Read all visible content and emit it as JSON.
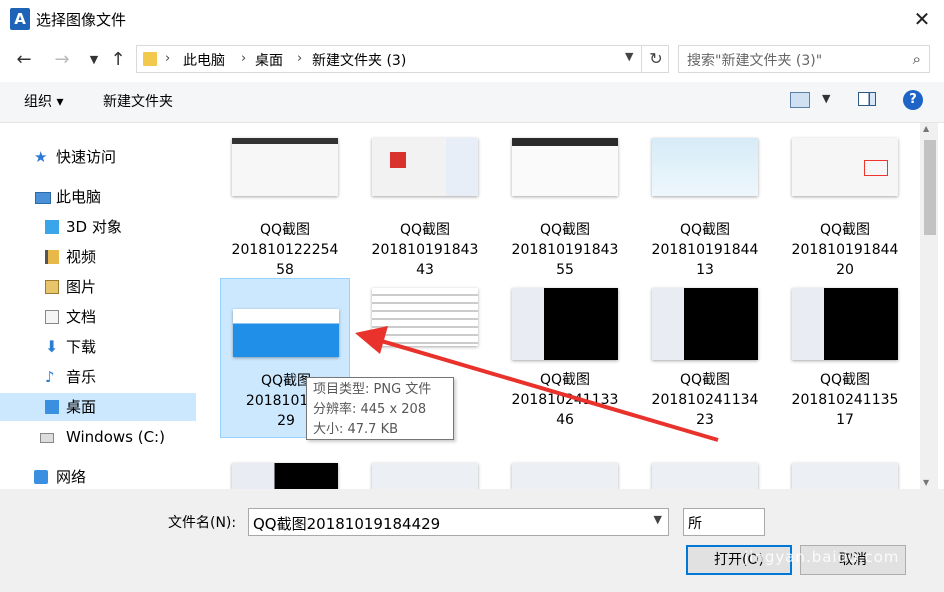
{
  "window": {
    "title": "选择图像文件",
    "close_glyph": "✕",
    "app_icon_letter": "A"
  },
  "address": {
    "breadcrumbs": [
      "此电脑",
      "桌面",
      "新建文件夹 (3)"
    ],
    "search_placeholder": "搜索\"新建文件夹 (3)\""
  },
  "toolbar": {
    "organize": "组织 ▾",
    "new_folder": "新建文件夹",
    "help": "?"
  },
  "nav": {
    "items": [
      {
        "label": "快速访问",
        "icon": "star-icon"
      },
      {
        "label": "此电脑",
        "icon": "computer-icon"
      },
      {
        "label": "3D 对象",
        "icon": "3d-objects-icon"
      },
      {
        "label": "视频",
        "icon": "video-icon"
      },
      {
        "label": "图片",
        "icon": "pictures-icon"
      },
      {
        "label": "文档",
        "icon": "documents-icon"
      },
      {
        "label": "下载",
        "icon": "download-icon"
      },
      {
        "label": "音乐",
        "icon": "music-icon"
      },
      {
        "label": "桌面",
        "icon": "desktop-icon"
      },
      {
        "label": "Windows (C:)",
        "icon": "drive-icon"
      },
      {
        "label": "网络",
        "icon": "network-icon"
      }
    ],
    "selected": "桌面"
  },
  "files": [
    {
      "line1": "QQ截图",
      "line2": "201810122254",
      "line3": "58"
    },
    {
      "line1": "QQ截图",
      "line2": "201810191843",
      "line3": "43"
    },
    {
      "line1": "QQ截图",
      "line2": "201810191843",
      "line3": "55"
    },
    {
      "line1": "QQ截图",
      "line2": "201810191844",
      "line3": "13"
    },
    {
      "line1": "QQ截图",
      "line2": "201810191844",
      "line3": "20"
    },
    {
      "line1": "QQ截图",
      "line2": "201810191",
      "line3": "29"
    },
    {
      "line1": "",
      "line2": "844",
      "line3": ""
    },
    {
      "line1": "QQ截图",
      "line2": "201810241133",
      "line3": "46"
    },
    {
      "line1": "QQ截图",
      "line2": "201810241134",
      "line3": "23"
    },
    {
      "line1": "QQ截图",
      "line2": "201810241135",
      "line3": "17"
    }
  ],
  "tooltip": {
    "type": "项目类型: PNG 文件",
    "resolution": "分辨率: 445 x 208",
    "size": "大小: 47.7 KB"
  },
  "bottom": {
    "filename_label": "文件名(N):",
    "filename_value": "QQ截图20181019184429",
    "filetype_value": "所",
    "open_label": "打开(O)",
    "cancel_label": "取消",
    "watermark": "jingyan.baidu.com"
  }
}
